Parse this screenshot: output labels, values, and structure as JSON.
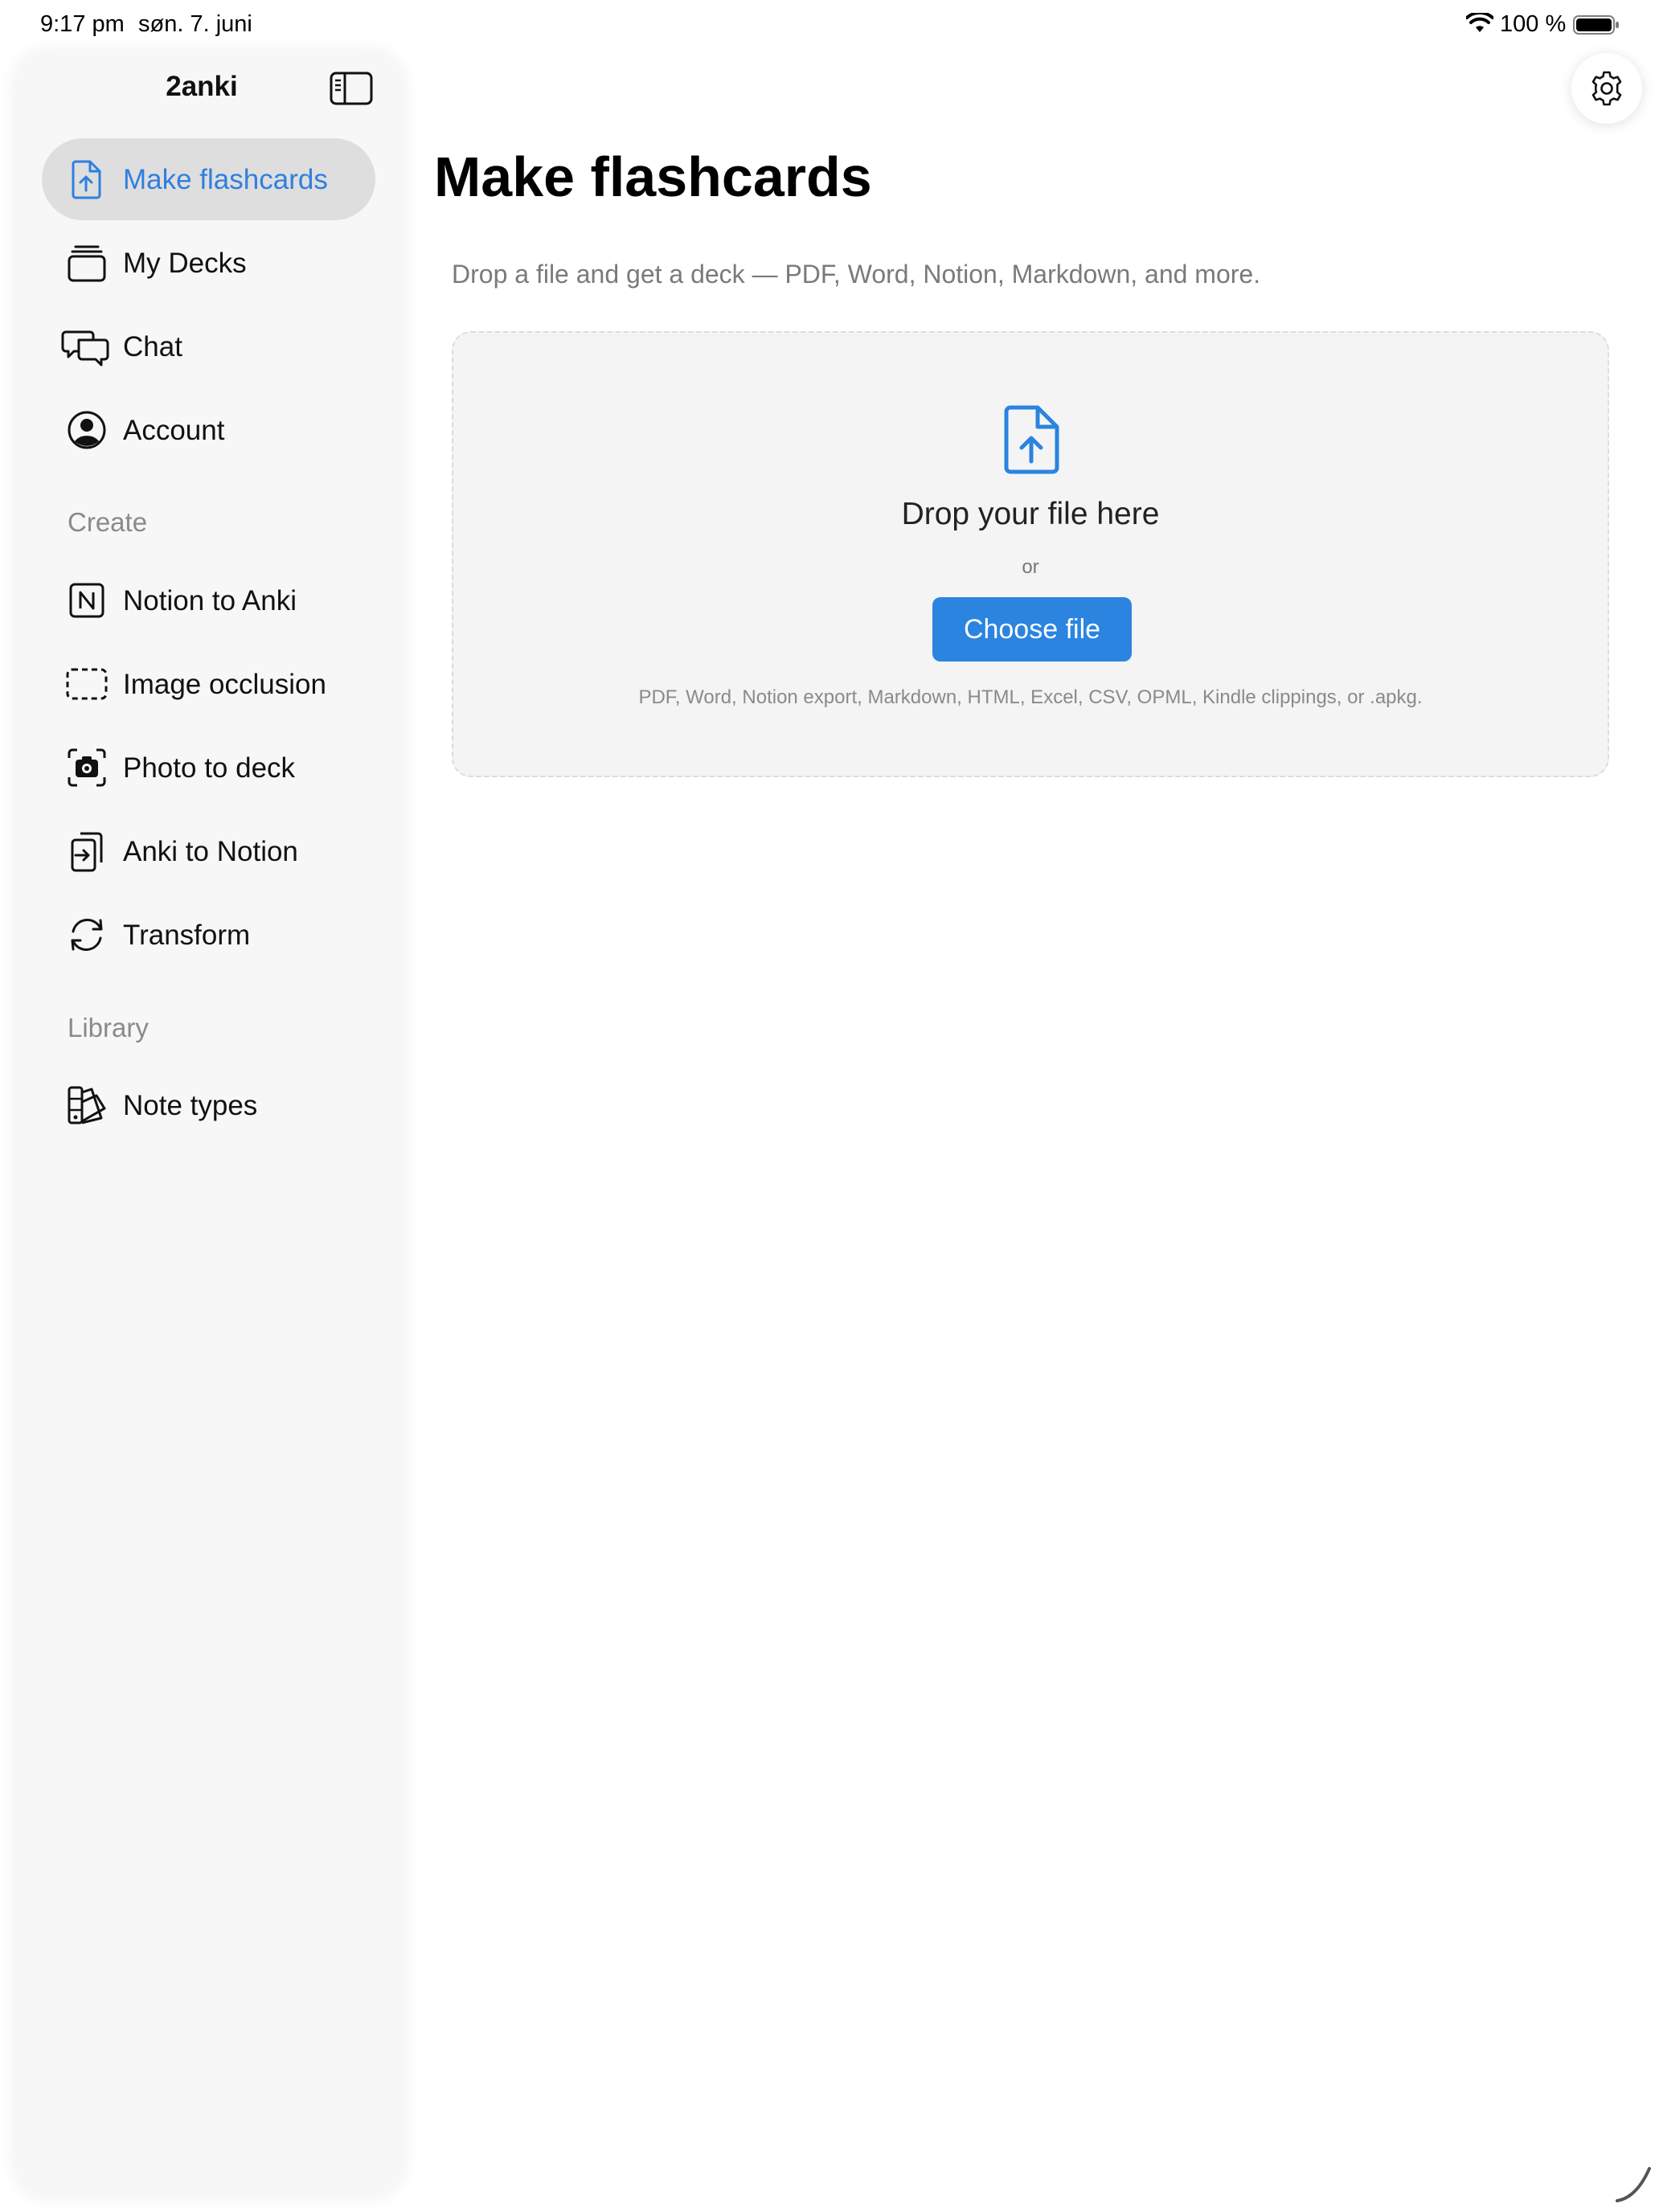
{
  "status_bar": {
    "time": "9:17 pm",
    "date": "søn. 7. juni",
    "battery_percent": "100 %",
    "battery_level": 1.0,
    "wifi_icon": "wifi-icon",
    "battery_icon": "battery-icon"
  },
  "sidebar": {
    "title": "2anki",
    "toggle_icon": "sidebar-toggle-icon",
    "items": [
      {
        "label": "Make flashcards",
        "icon": "file-upload-icon",
        "active": true
      },
      {
        "label": "My Decks",
        "icon": "stack-icon"
      },
      {
        "label": "Chat",
        "icon": "chat-bubbles-icon"
      },
      {
        "label": "Account",
        "icon": "person-circle-icon"
      }
    ],
    "create_section": {
      "label": "Create",
      "items": [
        {
          "label": "Notion to Anki",
          "icon": "notion-icon"
        },
        {
          "label": "Image occlusion",
          "icon": "dashed-rect-icon"
        },
        {
          "label": "Photo to deck",
          "icon": "camera-viewfinder-icon"
        },
        {
          "label": "Anki to Notion",
          "icon": "export-icon"
        },
        {
          "label": "Transform",
          "icon": "sync-icon"
        }
      ]
    },
    "library_section": {
      "label": "Library",
      "items": [
        {
          "label": "Note types",
          "icon": "swatches-icon"
        }
      ]
    }
  },
  "main": {
    "settings_icon": "gear-icon",
    "title": "Make flashcards",
    "subtitle": "Drop a file and get a deck — PDF, Word, Notion, Markdown, and more.",
    "dropzone": {
      "icon": "file-upload-icon",
      "title": "Drop your file here",
      "or": "or",
      "button_label": "Choose file",
      "hint": "PDF, Word, Notion export, Markdown, HTML, Excel, CSV, OPML, Kindle clippings, or .apkg."
    }
  },
  "colors": {
    "accent": "#2a84e0",
    "active_nav_bg": "#dedede",
    "sidebar_bg": "#f7f7f7",
    "dropzone_bg": "#f4f4f4"
  }
}
